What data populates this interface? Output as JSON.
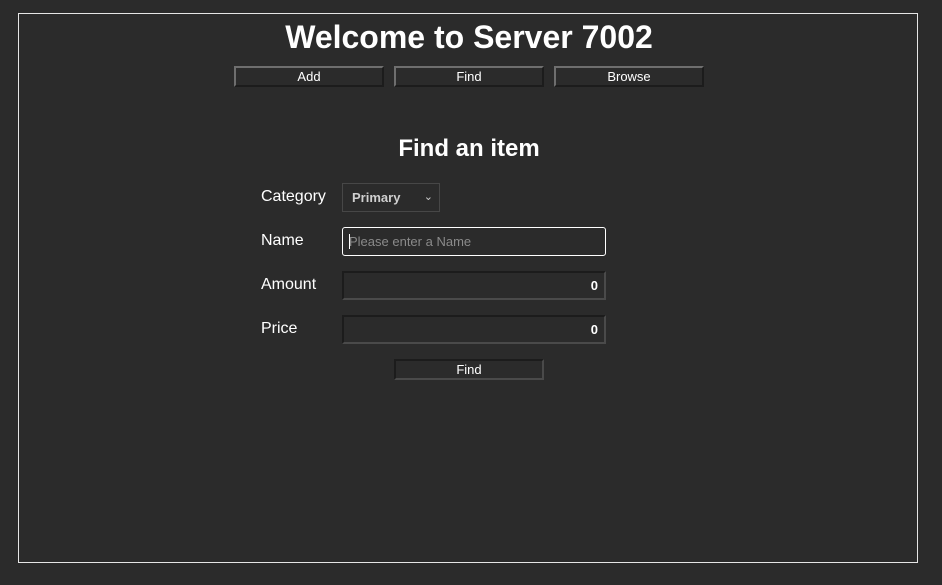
{
  "header": {
    "title": "Welcome to Server 7002"
  },
  "nav": {
    "add_label": "Add",
    "find_label": "Find",
    "browse_label": "Browse"
  },
  "form": {
    "title": "Find an item",
    "category": {
      "label": "Category",
      "selected": "Primary"
    },
    "name": {
      "label": "Name",
      "value": "",
      "placeholder": "Please enter a Name"
    },
    "amount": {
      "label": "Amount",
      "value": "0"
    },
    "price": {
      "label": "Price",
      "value": "0"
    },
    "submit_label": "Find"
  },
  "icons": {
    "select_arrow": "chevron-down-icon"
  },
  "colors": {
    "background": "#2b2b2b",
    "text": "#ffffff",
    "frame_border": "#e6e6e6"
  }
}
